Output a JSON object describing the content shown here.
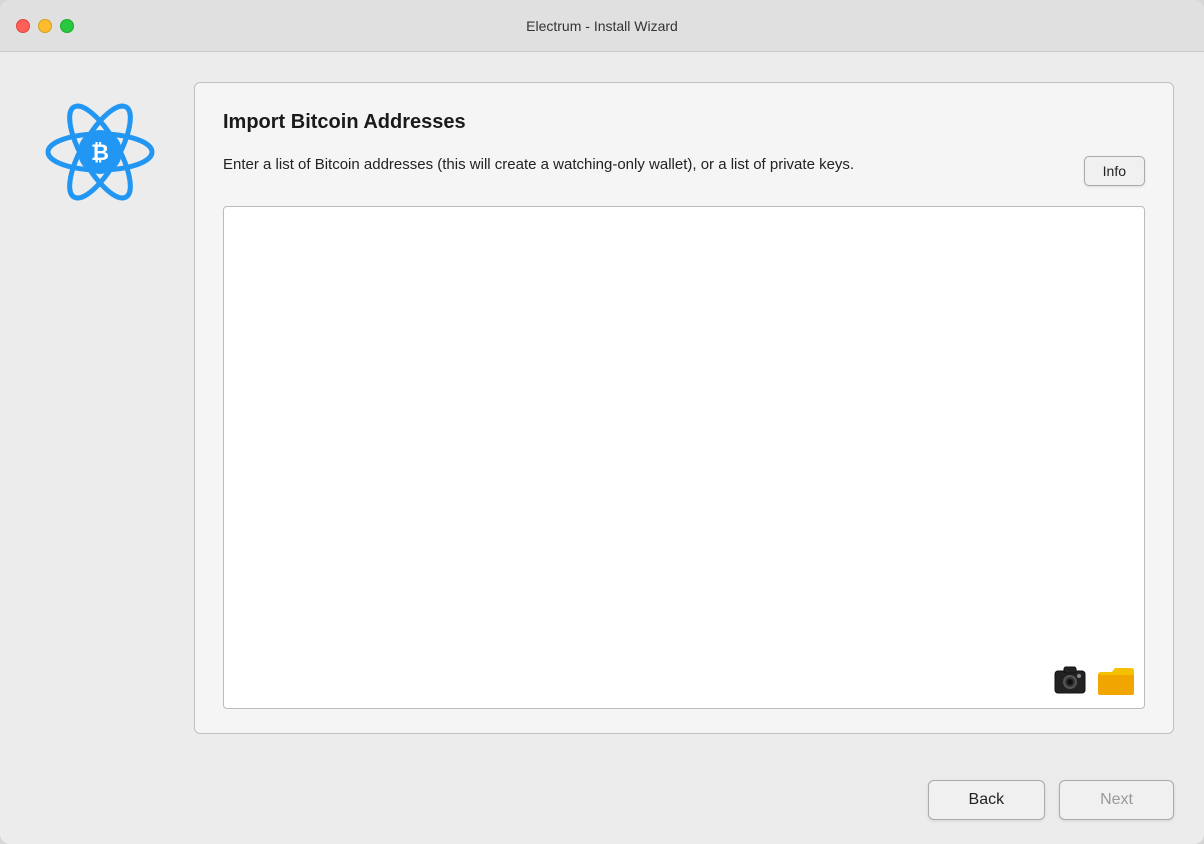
{
  "window": {
    "title": "Electrum  -  Install Wizard"
  },
  "traffic_lights": {
    "close_label": "close",
    "minimize_label": "minimize",
    "maximize_label": "maximize"
  },
  "panel": {
    "title": "Import Bitcoin Addresses",
    "description": "Enter a list of Bitcoin addresses (this will create a watching-only wallet), or a list of private keys.",
    "info_button_label": "Info",
    "textarea_placeholder": ""
  },
  "footer": {
    "back_label": "Back",
    "next_label": "Next"
  },
  "icons": {
    "camera": "📷",
    "folder": "📁"
  }
}
